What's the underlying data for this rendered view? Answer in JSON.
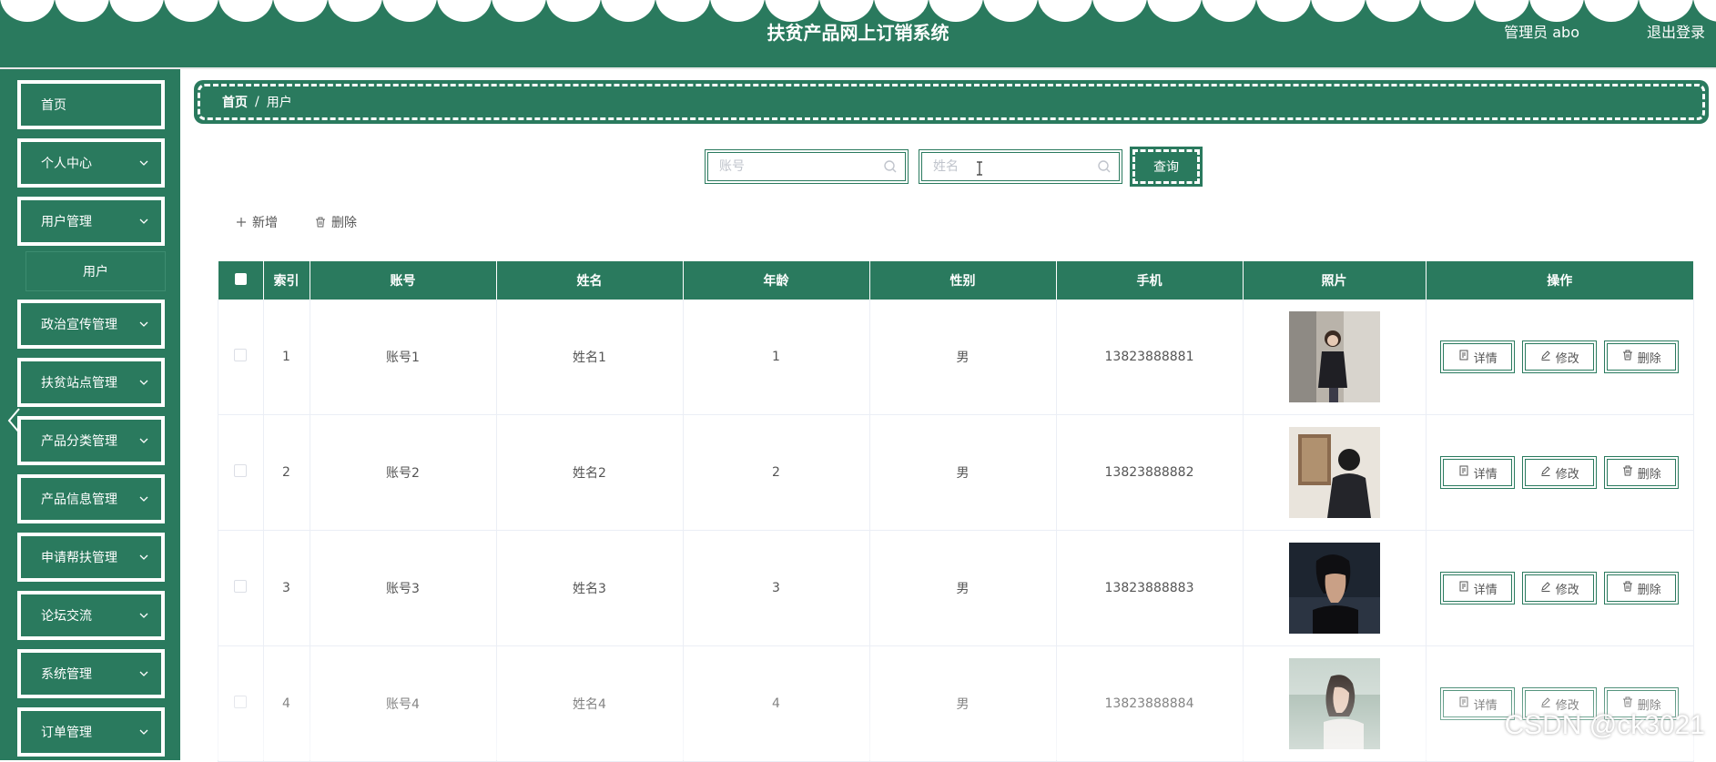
{
  "header": {
    "title": "扶贫产品网上订销系统",
    "user": "管理员 abo",
    "logout": "退出登录"
  },
  "sidebar": {
    "items": [
      {
        "label": "首页",
        "expandable": false
      },
      {
        "label": "个人中心",
        "expandable": true
      },
      {
        "label": "用户管理",
        "expandable": true
      },
      {
        "label": "政治宣传管理",
        "expandable": true
      },
      {
        "label": "扶贫站点管理",
        "expandable": true
      },
      {
        "label": "产品分类管理",
        "expandable": true
      },
      {
        "label": "产品信息管理",
        "expandable": true
      },
      {
        "label": "申请帮扶管理",
        "expandable": true
      },
      {
        "label": "论坛交流",
        "expandable": true
      },
      {
        "label": "系统管理",
        "expandable": true
      },
      {
        "label": "订单管理",
        "expandable": true
      }
    ],
    "submenu": {
      "label": "用户"
    }
  },
  "breadcrumb": {
    "home": "首页",
    "separator": "/",
    "current": "用户"
  },
  "search": {
    "account_placeholder": "账号",
    "name_placeholder": "姓名",
    "query_label": "查询"
  },
  "actions": {
    "add": "新增",
    "delete": "删除"
  },
  "table": {
    "columns": [
      "索引",
      "账号",
      "姓名",
      "年龄",
      "性别",
      "手机",
      "照片",
      "操作"
    ],
    "rows": [
      {
        "index": "1",
        "account": "账号1",
        "name": "姓名1",
        "age": "1",
        "gender": "男",
        "phone": "13823888881"
      },
      {
        "index": "2",
        "account": "账号2",
        "name": "姓名2",
        "age": "2",
        "gender": "男",
        "phone": "13823888882"
      },
      {
        "index": "3",
        "account": "账号3",
        "name": "姓名3",
        "age": "3",
        "gender": "男",
        "phone": "13823888883"
      },
      {
        "index": "4",
        "account": "账号4",
        "name": "姓名4",
        "age": "4",
        "gender": "男",
        "phone": "13823888884"
      }
    ],
    "row_actions": {
      "detail": "详情",
      "edit": "修改",
      "delete": "删除"
    }
  },
  "watermark": "CSDN @ck3021",
  "colors": {
    "primary": "#2a7a5e"
  }
}
